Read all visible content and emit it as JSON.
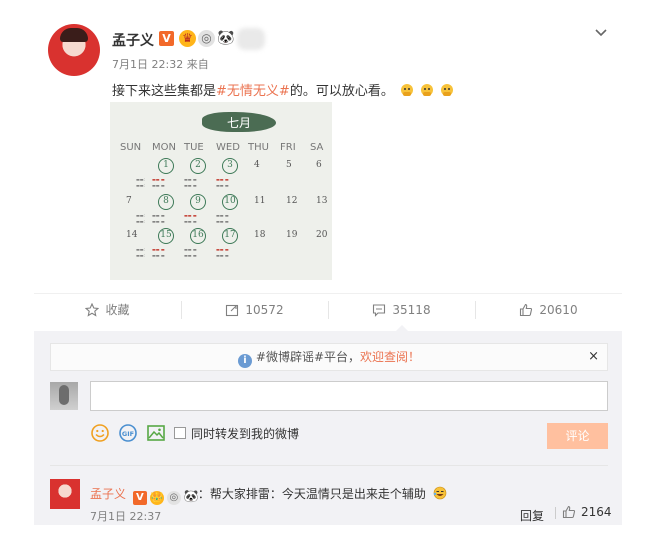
{
  "post": {
    "author": "孟子义",
    "vip_badge": "V",
    "time_source": "7月1日 22:32 来自",
    "text_before": "接下来这些集都是",
    "topic": "#无情无义#",
    "text_after": "的。可以放心看。",
    "emoji_icons": [
      "face-covering-mouth-icon",
      "face-covering-mouth-icon",
      "face-covering-mouth-icon"
    ]
  },
  "image": {
    "month_title": "七月",
    "day_names": [
      "SUN",
      "MON",
      "TUE",
      "WED",
      "THU",
      "FRI",
      "SA"
    ],
    "rows": [
      {
        "plain_left": "",
        "circled": [
          "1",
          "2",
          "3"
        ],
        "plain_right": [
          "4",
          "5",
          "6"
        ]
      },
      {
        "plain_left": "7",
        "circled": [
          "8",
          "9",
          "10"
        ],
        "plain_right": [
          "11",
          "12",
          "13"
        ]
      },
      {
        "plain_left": "14",
        "circled": [
          "15",
          "16",
          "17"
        ],
        "plain_right": [
          "18",
          "19",
          "20"
        ]
      }
    ]
  },
  "actions": {
    "favorite": "收藏",
    "repost_count": "10572",
    "comment_count": "35118",
    "like_count": "20610"
  },
  "comment_box": {
    "notice_prefix": "#微博辟谣#平台，",
    "notice_link": "欢迎查阅！",
    "close": "×",
    "input_value": "",
    "share_label": "同时转发到我的微博",
    "submit": "评论"
  },
  "comment": {
    "author": "孟子义",
    "badges": [
      "V",
      "👑",
      "◎",
      "🐼"
    ],
    "text": "：帮大家排雷：今天温情只是出来走个辅助",
    "time": "7月1日 22:37",
    "reply": "回复",
    "likes": "2164"
  },
  "colors": {
    "accent": "#eb7350",
    "panel_bg": "#f2f2f5",
    "submit_disabled": "#ffc09f",
    "calendar_green": "#3e7a58"
  }
}
